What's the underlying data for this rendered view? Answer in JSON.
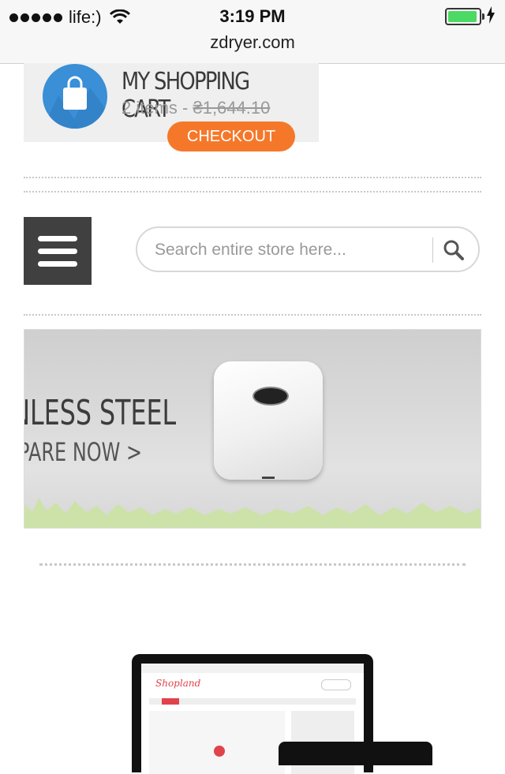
{
  "status_bar": {
    "carrier": "life:)",
    "time": "3:19 PM",
    "url": "zdryer.com",
    "battery_level": 0.95
  },
  "cart": {
    "title": "MY SHOPPING CART",
    "items_text": "2 items - ",
    "price": "₴1,644.10",
    "checkout_label": "CHECKOUT"
  },
  "search": {
    "placeholder": "Search entire store here..."
  },
  "banner": {
    "heading": "INLESS STEEL",
    "link": "PARE NOW >"
  },
  "preview": {
    "logo": "Shopland"
  },
  "colors": {
    "accent_orange": "#f5782a",
    "cart_blue": "#3a8fd6",
    "menu_dark": "#404040",
    "battery_green": "#4cd964"
  }
}
